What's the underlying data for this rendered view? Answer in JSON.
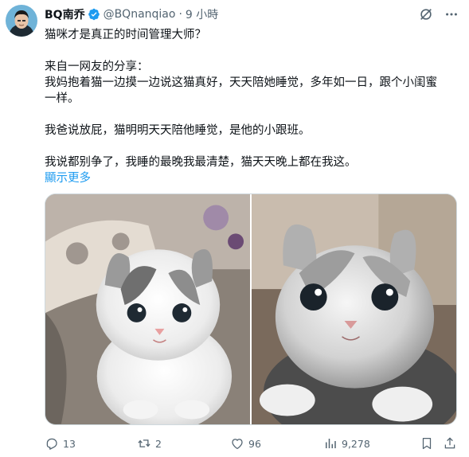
{
  "author": {
    "display_name": "BQ南乔",
    "handle": "@BQnanqiao",
    "separator": "·",
    "time": "9 小時",
    "verified": true
  },
  "tweet": {
    "title_line": "猫咪才是真正的时间管理大师？",
    "para1_line1": "来自一网友的分享：",
    "para1_line2": "我妈抱着猫一边摸一边说这猫真好，天天陪她睡觉，多年如一日，跟个小闺蜜",
    "para1_line3": "一样。",
    "para2": "我爸说放屁，猫明明天天陪他睡觉，是他的小跟班。",
    "para3": "我说都别争了，我睡的最晚我最清楚，猫天天晚上都在我这。",
    "show_more": "顯示更多"
  },
  "media": [
    {
      "subject": "fluffy white and grey kitten on patterned cushion"
    },
    {
      "subject": "silver tabby kitten with blue eyes"
    }
  ],
  "actions": {
    "replies": "13",
    "retweets": "2",
    "likes": "96",
    "views": "9,278"
  },
  "colors": {
    "accent": "#1d9bf0",
    "text": "#0f1419",
    "secondary": "#536471",
    "border": "#cfd9de"
  },
  "icons": [
    "grok-icon",
    "more-icon",
    "reply-icon",
    "retweet-icon",
    "like-icon",
    "views-icon",
    "bookmark-icon",
    "share-icon",
    "verified-badge-icon"
  ]
}
